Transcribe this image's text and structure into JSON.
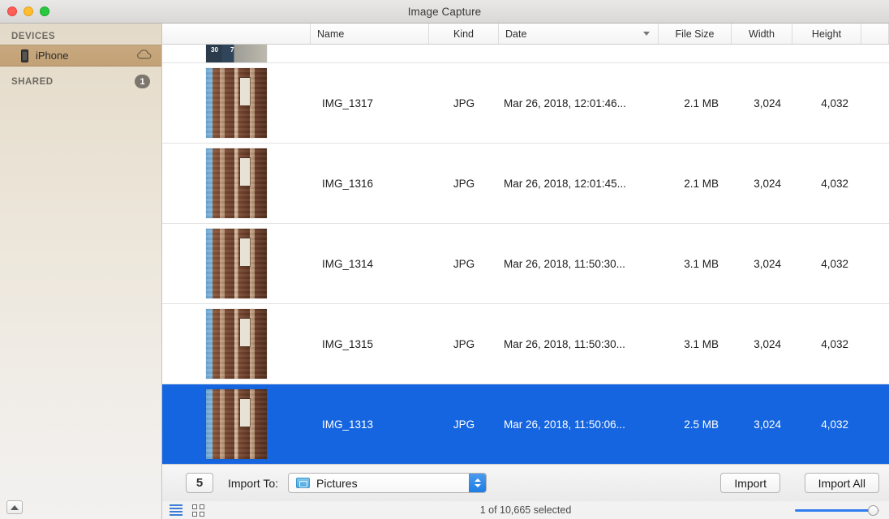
{
  "window": {
    "title": "Image Capture",
    "traffic_lights": [
      "close-button",
      "minimize-button",
      "maximize-button"
    ]
  },
  "sidebar": {
    "sections": [
      {
        "header": "DEVICES",
        "badge": "",
        "items": [
          {
            "label": "iPhone",
            "icon": "iphone-icon",
            "trailing_icon": "cloud-icon",
            "selected": true
          }
        ]
      },
      {
        "header": "SHARED",
        "badge": "1",
        "items": []
      }
    ],
    "eject_label": "Eject"
  },
  "columns": [
    {
      "key": "thumb",
      "label": ""
    },
    {
      "key": "name",
      "label": "Name"
    },
    {
      "key": "kind",
      "label": "Kind"
    },
    {
      "key": "date",
      "label": "Date",
      "sorted": true,
      "sort_dir": "desc"
    },
    {
      "key": "size",
      "label": "File Size"
    },
    {
      "key": "width",
      "label": "Width"
    },
    {
      "key": "height",
      "label": "Height"
    }
  ],
  "rows": [
    {
      "partial": true,
      "thumb": "calendar-screenshot-thumbnail",
      "thumb_labels": [
        "30",
        "7"
      ],
      "name": "",
      "kind": "",
      "date": "",
      "size": "",
      "width": "",
      "height": "",
      "selected": false
    },
    {
      "partial": false,
      "thumb": "building-photo-thumbnail",
      "name": "IMG_1317",
      "kind": "JPG",
      "date": "Mar 26, 2018, 12:01:46...",
      "size": "2.1 MB",
      "width": "3,024",
      "height": "4,032",
      "selected": false
    },
    {
      "partial": false,
      "thumb": "building-photo-thumbnail",
      "name": "IMG_1316",
      "kind": "JPG",
      "date": "Mar 26, 2018, 12:01:45...",
      "size": "2.1 MB",
      "width": "3,024",
      "height": "4,032",
      "selected": false
    },
    {
      "partial": false,
      "thumb": "building-photo-thumbnail",
      "name": "IMG_1314",
      "kind": "JPG",
      "date": "Mar 26, 2018, 11:50:30...",
      "size": "3.1 MB",
      "width": "3,024",
      "height": "4,032",
      "selected": false
    },
    {
      "partial": false,
      "thumb": "building-photo-thumbnail",
      "name": "IMG_1315",
      "kind": "JPG",
      "date": "Mar 26, 2018, 11:50:30...",
      "size": "3.1 MB",
      "width": "3,024",
      "height": "4,032",
      "selected": false
    },
    {
      "partial": false,
      "thumb": "building-photo-thumbnail",
      "name": "IMG_1313",
      "kind": "JPG",
      "date": "Mar 26, 2018, 11:50:06...",
      "size": "2.5 MB",
      "width": "3,024",
      "height": "4,032",
      "selected": true
    }
  ],
  "bottom_bar": {
    "rotate_label": "5",
    "import_to_label": "Import To:",
    "destination": "Pictures",
    "destination_icon": "folder-icon",
    "import_button": "Import",
    "import_all_button": "Import All"
  },
  "status_bar": {
    "list_view_icon": "list-view-icon",
    "grid_view_icon": "grid-view-icon",
    "selection_text": "1 of 10,665 selected",
    "zoom_slider_value": 88
  },
  "colors": {
    "selection_blue": "#1565e0",
    "sidebar_selected": "#c8a87e",
    "accent_blue": "#2f7df0",
    "traffic_red": "#ff5f57",
    "traffic_yellow": "#ffbd2e",
    "traffic_green": "#28c840"
  }
}
